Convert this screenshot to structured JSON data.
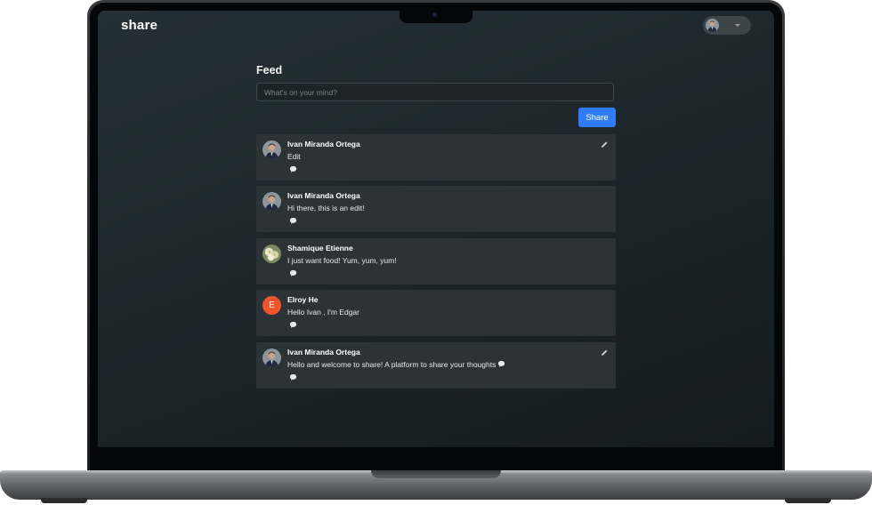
{
  "app": {
    "name": "share"
  },
  "feed": {
    "title": "Feed",
    "input_placeholder": "What's on your mind?",
    "share_label": "Share"
  },
  "colors": {
    "accent": "#2f7cf6",
    "card": "#2b3336",
    "elroy_avatar": "#f0542d"
  },
  "posts": [
    {
      "author": "Ivan Miranda Ortega",
      "content": "Edit",
      "avatar": "photo-man",
      "editable": true
    },
    {
      "author": "Ivan Miranda Ortega",
      "content": "Hi there, this is an edit!",
      "avatar": "photo-man",
      "editable": false
    },
    {
      "author": "Shamique Etienne",
      "content": "I just want food! Yum, yum, yum!",
      "avatar": "photo-flowers",
      "editable": false
    },
    {
      "author": "Elroy He",
      "content": "Hello Ivan , I'm Edgar",
      "avatar": "letter",
      "avatar_letter": "E",
      "editable": false
    },
    {
      "author": "Ivan Miranda Ortega",
      "content": "Hello and welcome to share! A platform to share your thoughts",
      "avatar": "photo-man",
      "editable": true,
      "trailing_icon": "speech-bubble-icon"
    }
  ]
}
